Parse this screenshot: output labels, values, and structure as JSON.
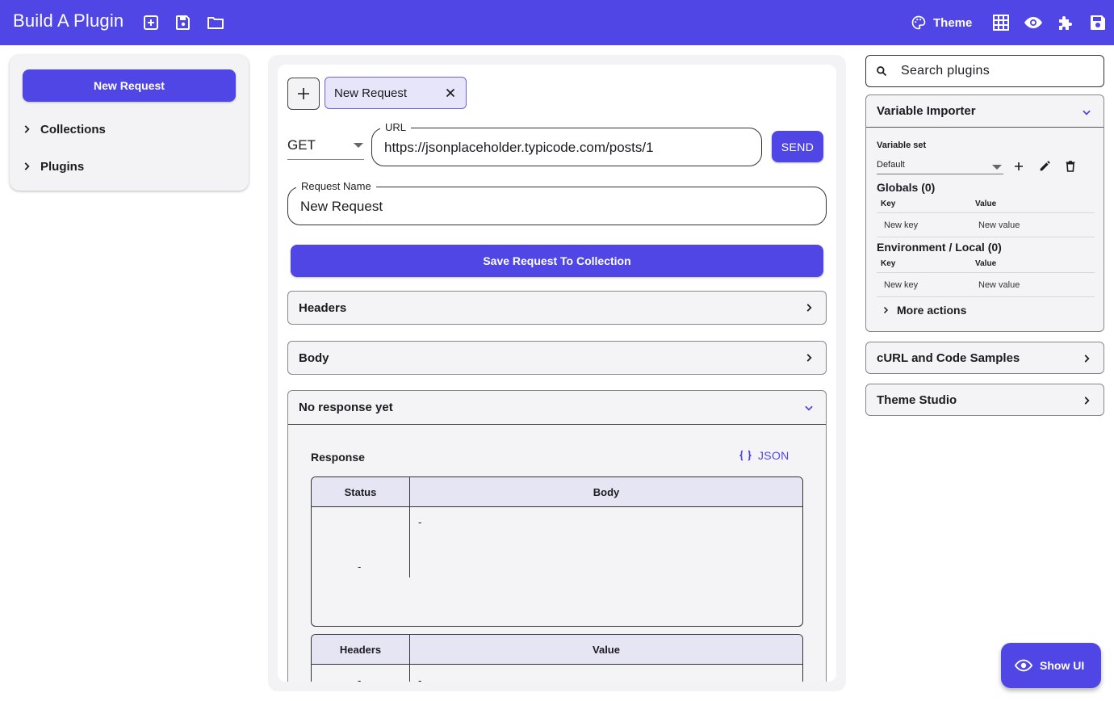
{
  "app": {
    "title": "Build A Plugin",
    "accent": "#4f46e5",
    "toolbar_left_icons": [
      "add-box-icon",
      "save-icon",
      "folder-icon"
    ],
    "theme_label": "Theme",
    "toolbar_right_icons": [
      "grid-icon",
      "eye-icon",
      "puzzle-icon",
      "save-icon"
    ]
  },
  "sidebar": {
    "new_request_label": "New Request",
    "items": [
      {
        "label": "Collections",
        "icon": "chevron-right-icon"
      },
      {
        "label": "Plugins",
        "icon": "chevron-right-icon"
      }
    ]
  },
  "main": {
    "tab": {
      "label": "New Request"
    },
    "method": "GET",
    "url_label": "URL",
    "url_value": "https://jsonplaceholder.typicode.com/posts/1",
    "send_label": "SEND",
    "name_label": "Request Name",
    "name_value": "New Request",
    "save_label": "Save Request To Collection",
    "sections": [
      {
        "label": "Headers"
      },
      {
        "label": "Body"
      }
    ],
    "response": {
      "title": "No response yet",
      "label": "Response",
      "json_label": "JSON",
      "status_table": {
        "columns": [
          "Status",
          "Body"
        ],
        "status": "-",
        "body": "-"
      },
      "headers_table": {
        "columns": [
          "Headers",
          "Value"
        ],
        "header": "-",
        "value": "-"
      }
    }
  },
  "right": {
    "search_placeholder": "Search plugins",
    "variable_importer": {
      "title": "Variable Importer",
      "set_label": "Variable set",
      "set_value": "Default",
      "globals_title": "Globals (0)",
      "env_title": "Environment / Local (0)",
      "key_header": "Key",
      "value_header": "Value",
      "new_key": "New key",
      "new_value": "New value",
      "more_actions": "More actions"
    },
    "panels": [
      {
        "label": "cURL and Code Samples"
      },
      {
        "label": "Theme Studio"
      }
    ]
  },
  "fab": {
    "label": "Show UI"
  }
}
